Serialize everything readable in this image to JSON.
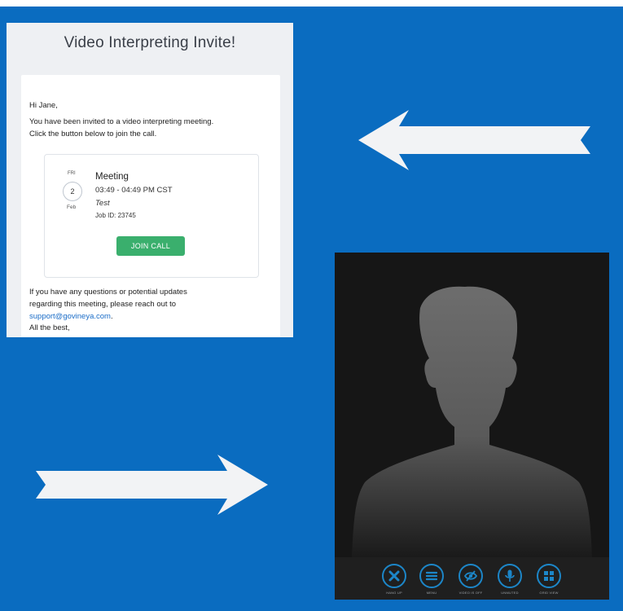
{
  "email": {
    "title": "Video Interpreting Invite!",
    "greeting": "Hi Jane,",
    "intro_line1": "You have been invited to a video interpreting meeting.",
    "intro_line2": "Click the button below to join the call.",
    "meeting": {
      "day_of_week": "FRI",
      "day": "2",
      "month": "Feb",
      "title": "Meeting",
      "time": "03:49 - 04:49 PM CST",
      "subtitle": "Test",
      "job_id": "Job ID: 23745",
      "join_label": "JOIN CALL"
    },
    "outro_line1": "If you have any questions or potential updates",
    "outro_line2": "regarding this meeting, please reach out to",
    "support_email": "support@govineya.com",
    "support_suffix": ".",
    "signoff": "All the best,"
  },
  "video": {
    "toolbar": [
      {
        "label": "HANG UP",
        "icon": "close-icon"
      },
      {
        "label": "MENU",
        "icon": "menu-icon"
      },
      {
        "label": "VIDEO IS OFF",
        "icon": "eye-off-icon"
      },
      {
        "label": "UNMUTED",
        "icon": "microphone-icon"
      },
      {
        "label": "GRID VIEW",
        "icon": "grid-icon"
      }
    ]
  },
  "colors": {
    "background": "#0a6cc0",
    "join_button": "#3aaf6d",
    "link": "#1a6cc7",
    "toolbar_accent": "#1c86c8"
  }
}
